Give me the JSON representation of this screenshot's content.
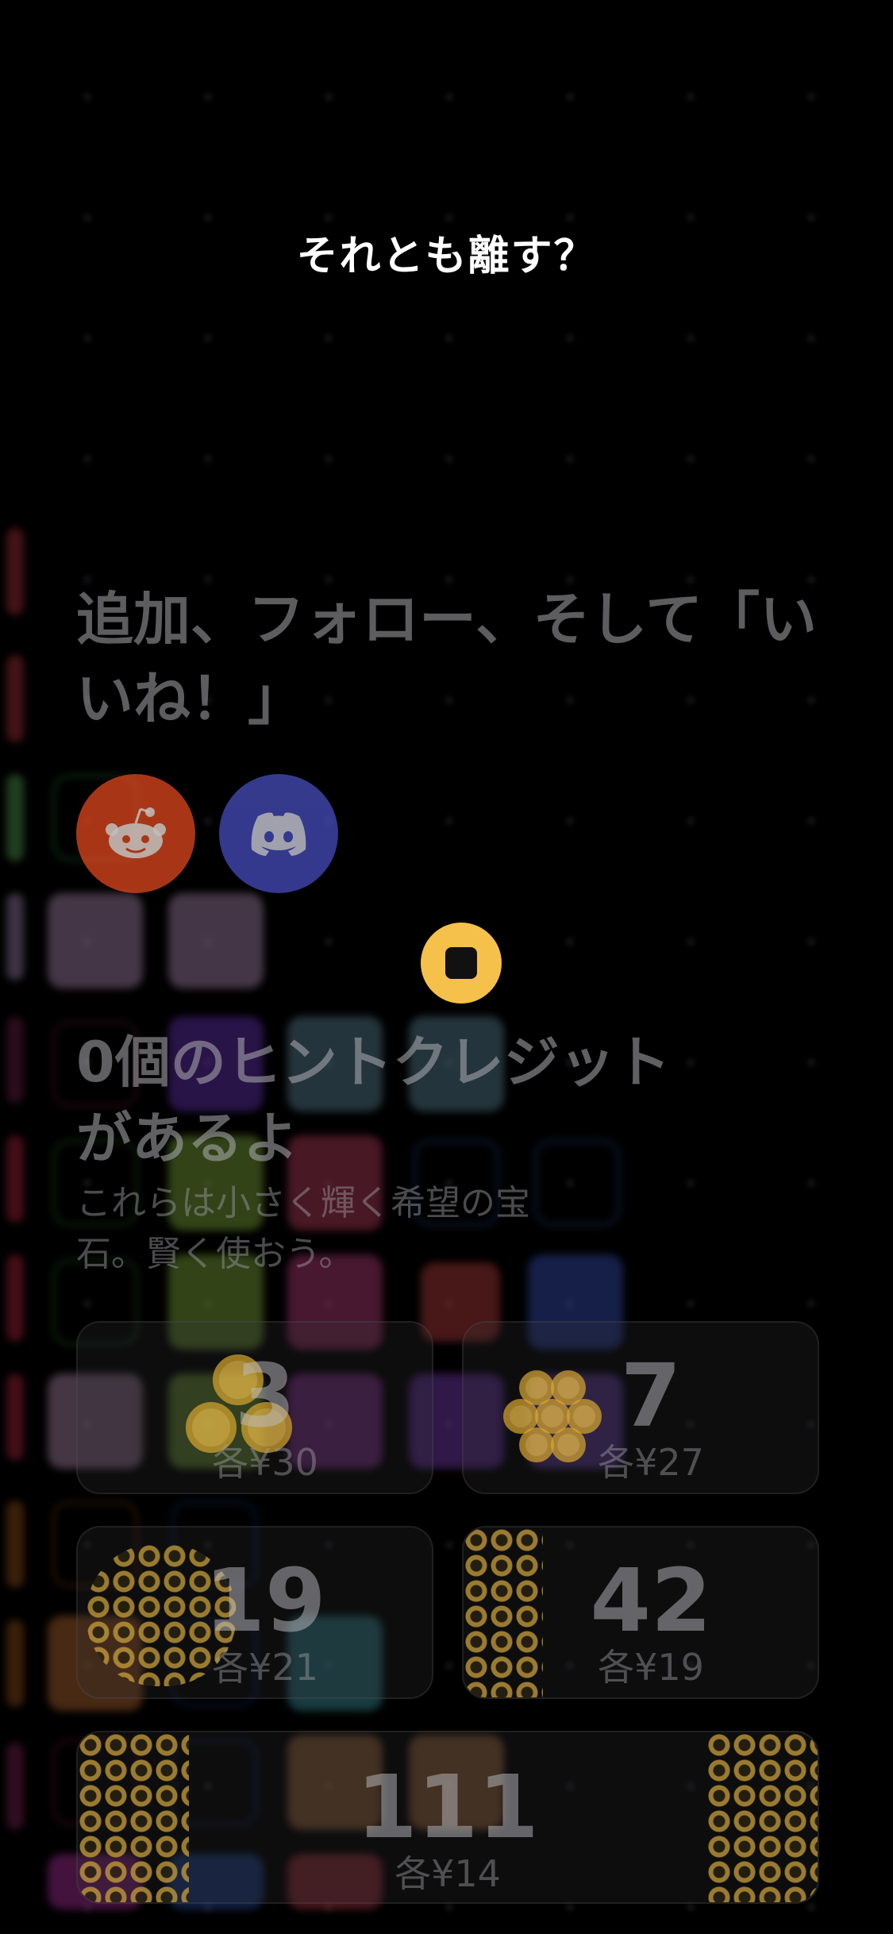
{
  "overlay": {
    "prompt_title": "それとも離す？",
    "follow_heading": "追加、フォロー、そして「いいね！」",
    "hints_title": "0個のヒントクレジットがあるよ",
    "hints_description": "これらは小さく輝く希望の宝石。賢く使おう。"
  },
  "social": [
    {
      "name": "reddit",
      "icon": "reddit-icon",
      "color": "#e0481e"
    },
    {
      "name": "discord",
      "icon": "discord-icon",
      "color": "#4b52c9"
    }
  ],
  "coin_icon": "coin-icon",
  "packs": [
    {
      "count": "3",
      "price": "各¥30"
    },
    {
      "count": "7",
      "price": "各¥27"
    },
    {
      "count": "19",
      "price": "各¥21"
    },
    {
      "count": "42",
      "price": "各¥19"
    },
    {
      "count": "111",
      "price": "各¥14"
    }
  ],
  "colors": {
    "coin": "#f6c14a",
    "background": "#000000"
  }
}
